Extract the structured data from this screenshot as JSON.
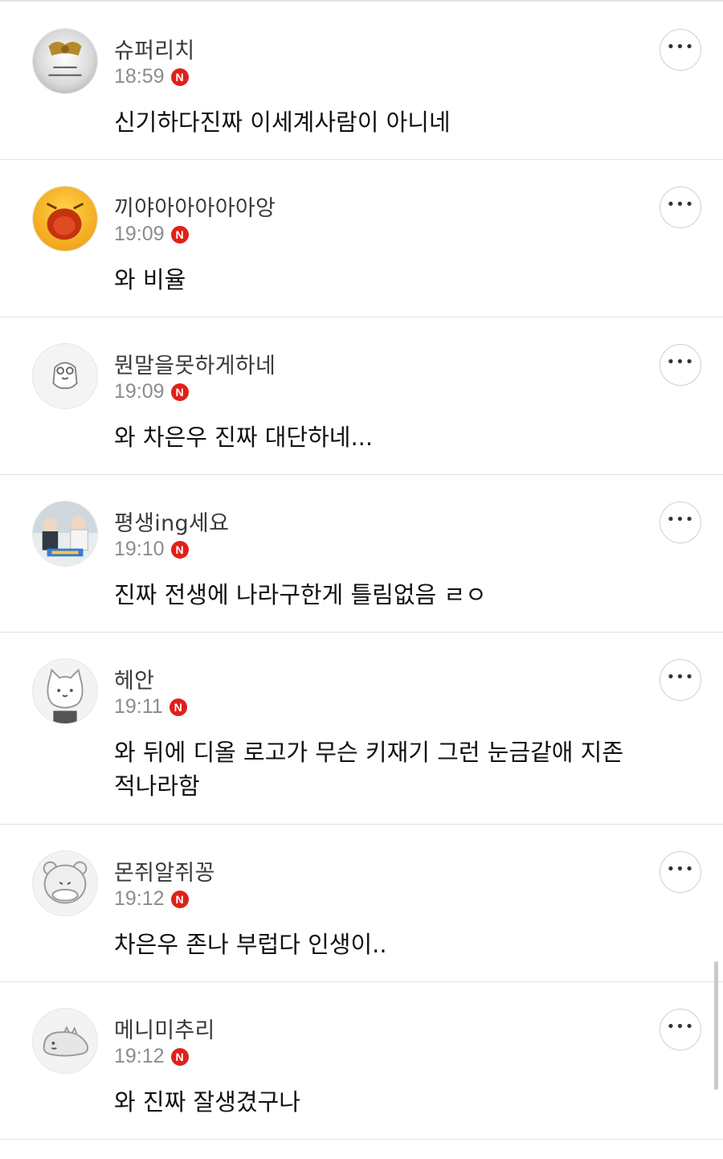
{
  "badge_label": "N",
  "more_label": "•••",
  "comments": [
    {
      "username": "슈퍼리치",
      "time": "18:59",
      "text": "신기하다진짜 이세계사람이 아니네",
      "avatar": "avatar-seal-icon"
    },
    {
      "username": "끼야아아아아아앙",
      "time": "19:09",
      "text": "와 비율",
      "avatar": "avatar-screaming-emoji-icon"
    },
    {
      "username": "뭔말을못하게하네",
      "time": "19:09",
      "text": "와 차은우 진짜 대단하네...",
      "avatar": "avatar-character-icon"
    },
    {
      "username": "평생ing세요",
      "time": "19:10",
      "text": "진짜 전생에 나라구한게 틀림없음 ㄹㅇ",
      "avatar": "avatar-photo-icon"
    },
    {
      "username": "헤안",
      "time": "19:11",
      "text": "와 뒤에 디올 로고가 무슨 키재기 그런 눈금같애 지존 적나라함",
      "avatar": "avatar-cat-icon"
    },
    {
      "username": "몬쥐알쥐꽁",
      "time": "19:12",
      "text": "차은우 존나 부럽다 인생이..",
      "avatar": "avatar-bear-icon"
    },
    {
      "username": "메니미추리",
      "time": "19:12",
      "text": "와 진짜 잘생겼구나",
      "avatar": "avatar-dino-icon"
    }
  ],
  "colors": {
    "badge": "#e0201b",
    "username": "#3a3a3a",
    "time": "#8c8c8c",
    "text": "#111111",
    "divider": "#e2e2e2"
  }
}
